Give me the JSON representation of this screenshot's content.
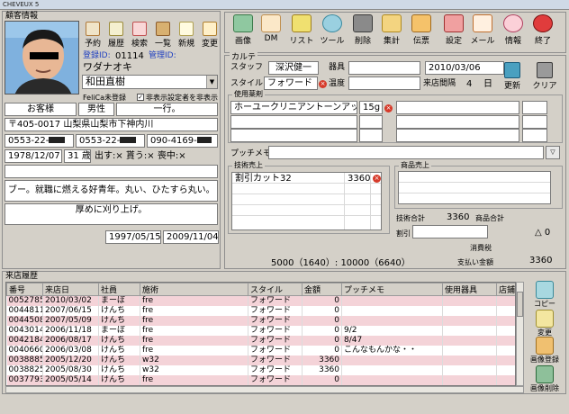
{
  "window": {
    "title": "CHEVEUX 5"
  },
  "customer": {
    "section_title": "顧客情報",
    "toolbar": [
      "予約",
      "履歴",
      "検索",
      "一覧",
      "新規",
      "変更"
    ],
    "reg_id_label": "登録ID:",
    "reg_id": "01114",
    "admin_id_label": "管理ID:",
    "kana": "ワダナオキ",
    "name": "和田直樹",
    "felica": "FeliCa未登録",
    "hide_label": "非表示設定者を非表示",
    "type": "お客様",
    "gender": "男性",
    "field_ichiko": "一行。",
    "address": "〒405-0017 山梨県山梨市下神内川",
    "phone1": "0553-22-",
    "phone2": "0553-22-",
    "mobile": "090-4169-",
    "birthday": "1978/12/07",
    "age": "31 歳",
    "dm_status": "出す:×  貰う:×  喪中:×",
    "memo1": "ブー。就職に燃える好青年。丸い、ひたすら丸い。",
    "memo2": "厚めに刈り上げ。",
    "first_visit": "1997/05/15",
    "last_visit": "2009/11/04"
  },
  "main_toolbar": [
    "画像",
    "DM",
    "リスト",
    "ツール",
    "削除",
    "集計",
    "伝票",
    "設定",
    "メール",
    "情報",
    "終了"
  ],
  "karte": {
    "title": "カルテ",
    "staff_label": "スタッフ",
    "staff": "深沢健一",
    "tool_label": "器具",
    "date": "2010/03/06",
    "style_label": "スタイル",
    "style": "フォワード",
    "temp_label": "温度",
    "visit_count_label": "来店間隔",
    "visit_count": "4",
    "visit_unit": "日",
    "update_label": "更新",
    "clear_label": "クリア",
    "chemicals_title": "使用薬剤",
    "chemical1": "ホーユークリニアントーンアップ（",
    "chemical1_amount": "15g",
    "petit_memo_label": "プッチメモ",
    "tech_sales_title": "技術売上",
    "tech_item": "割引カット32",
    "tech_price": "3360",
    "product_sales_title": "商品売上",
    "tech_total_label": "技術合計",
    "tech_total": "3360",
    "product_total_label": "商品合計",
    "discount_label": "割引",
    "discount_value": "△ 0",
    "tax_label": "消費税",
    "points": "5000（1640）: 10000（6640）",
    "payment_label": "支払い金額",
    "payment": "3360"
  },
  "history": {
    "title": "来店履歴",
    "columns": [
      "番号",
      "来店日",
      "社員",
      "施術",
      "スタイル",
      "金額",
      "プッチメモ",
      "使用器具",
      "店鋪"
    ],
    "rows": [
      {
        "no": "0052785",
        "date": "2010/03/02",
        "staff": "まーぼ",
        "treat": "fre",
        "style": "フォワード",
        "amount": "0",
        "memo": "",
        "tool": "",
        "shop": ""
      },
      {
        "no": "0044811",
        "date": "2007/06/15",
        "staff": "けんち",
        "treat": "fre",
        "style": "フォワード",
        "amount": "0",
        "memo": "",
        "tool": "",
        "shop": ""
      },
      {
        "no": "0044508",
        "date": "2007/05/09",
        "staff": "けんち",
        "treat": "fre",
        "style": "フォワード",
        "amount": "0",
        "memo": "",
        "tool": "",
        "shop": ""
      },
      {
        "no": "0043014",
        "date": "2006/11/18",
        "staff": "まーぼ",
        "treat": "fre",
        "style": "フォワード",
        "amount": "0",
        "memo": "9/2",
        "tool": "",
        "shop": ""
      },
      {
        "no": "0042184",
        "date": "2006/08/17",
        "staff": "けんち",
        "treat": "fre",
        "style": "フォワード",
        "amount": "0",
        "memo": "8/47",
        "tool": "",
        "shop": ""
      },
      {
        "no": "0040660",
        "date": "2006/03/08",
        "staff": "けんち",
        "treat": "fre",
        "style": "フォワード",
        "amount": "0",
        "memo": "こんなもんかな・・",
        "tool": "",
        "shop": ""
      },
      {
        "no": "0038885",
        "date": "2005/12/20",
        "staff": "けんち",
        "treat": "w32",
        "style": "フォワード",
        "amount": "3360",
        "memo": "",
        "tool": "",
        "shop": ""
      },
      {
        "no": "0038825",
        "date": "2005/08/30",
        "staff": "けんち",
        "treat": "w32",
        "style": "フォワード",
        "amount": "3360",
        "memo": "",
        "tool": "",
        "shop": ""
      },
      {
        "no": "0037793",
        "date": "2005/05/14",
        "staff": "けんち",
        "treat": "fre",
        "style": "フォワード",
        "amount": "0",
        "memo": "",
        "tool": "",
        "shop": ""
      }
    ],
    "side_buttons": [
      "コピー",
      "変更",
      "画像登録",
      "画像削除"
    ]
  },
  "colors": {
    "pink_row": "#f4d3d8",
    "panel": "#d4d0c8",
    "accent_red": "#d63a2a"
  }
}
